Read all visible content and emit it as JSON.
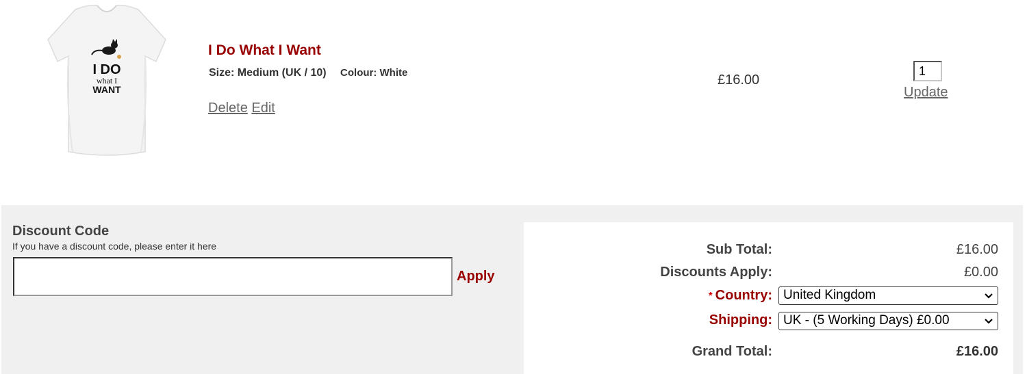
{
  "cart_item": {
    "title": "I Do What I Want",
    "size_label": "Size: Medium (UK / 10)",
    "colour_label": "Colour: White",
    "delete_label": "Delete",
    "edit_label": "Edit",
    "price": "£16.00",
    "quantity": "1",
    "update_label": "Update",
    "image": {
      "icon": "white-tshirt-product-image",
      "print_line1": "I DO",
      "print_line2": "what I",
      "print_line3": "WANT"
    }
  },
  "discount": {
    "title": "Discount Code",
    "help_text": "If you have a discount code, please enter it here",
    "input_value": "",
    "apply_label": "Apply"
  },
  "totals": {
    "sub_total_label": "Sub Total:",
    "sub_total_value": "£16.00",
    "discounts_label": "Discounts Apply:",
    "discounts_value": "£0.00",
    "country_required_mark": "*",
    "country_label": "Country:",
    "country_value": "United Kingdom",
    "shipping_label": "Shipping:",
    "shipping_value": "UK - (5 Working Days) £0.00",
    "grand_total_label": "Grand Total:",
    "grand_total_value": "£16.00"
  },
  "colors": {
    "accent_red": "#990000",
    "panel_bg": "#f0f0f0",
    "link_gray": "#666666"
  }
}
